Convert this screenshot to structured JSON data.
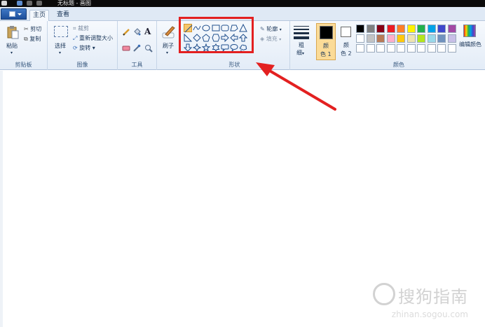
{
  "window": {
    "title": "无标题 - 画图"
  },
  "tabs": {
    "home": "主页",
    "view": "查看"
  },
  "clipboard": {
    "paste": "粘贴",
    "cut": "剪切",
    "copy": "复制",
    "group_label": "剪贴板"
  },
  "image": {
    "select": "选择",
    "crop": "裁剪",
    "resize": "重新调整大小",
    "rotate": "旋转",
    "group_label": "图像"
  },
  "tools": {
    "group_label": "工具",
    "text_tool": "A"
  },
  "brushes": {
    "label": "刷子"
  },
  "shapes": {
    "group_label": "形状",
    "outline": "轮廓",
    "fill": "填充",
    "gallery": [
      "line",
      "curve",
      "oval",
      "rectangle",
      "rounded-rectangle",
      "polygon",
      "triangle",
      "right-triangle",
      "diamond",
      "pentagon",
      "hexagon",
      "right-arrow",
      "left-arrow",
      "up-arrow",
      "down-arrow",
      "four-point-star",
      "five-point-star",
      "six-point-star",
      "rounded-callout",
      "oval-callout",
      "cloud-callout"
    ],
    "selected": "line"
  },
  "size": {
    "label_line1": "粗",
    "label_line2": "细"
  },
  "colors": {
    "group_label": "颜色",
    "color1_line1": "颜",
    "color1_line2": "色 1",
    "color2_line1": "颜",
    "color2_line2": "色 2",
    "color1": "#000000",
    "color2": "#ffffff",
    "edit_colors": "编辑颜色",
    "palette_row1": [
      "#000000",
      "#7f7f7f",
      "#880015",
      "#ed1c24",
      "#ff7f27",
      "#fff200",
      "#22b14c",
      "#00a2e8",
      "#3f48cc",
      "#a349a4"
    ],
    "palette_row2": [
      "#ffffff",
      "#c3c3c3",
      "#b97a57",
      "#ffaec9",
      "#ffc90e",
      "#efe4b0",
      "#b5e61d",
      "#99d9ea",
      "#7092be",
      "#c8bfe7"
    ]
  },
  "annotation": {
    "highlight_color": "#e32020"
  },
  "watermark": {
    "main": "搜狗指南",
    "sub": "zhinan.sogou.com"
  }
}
